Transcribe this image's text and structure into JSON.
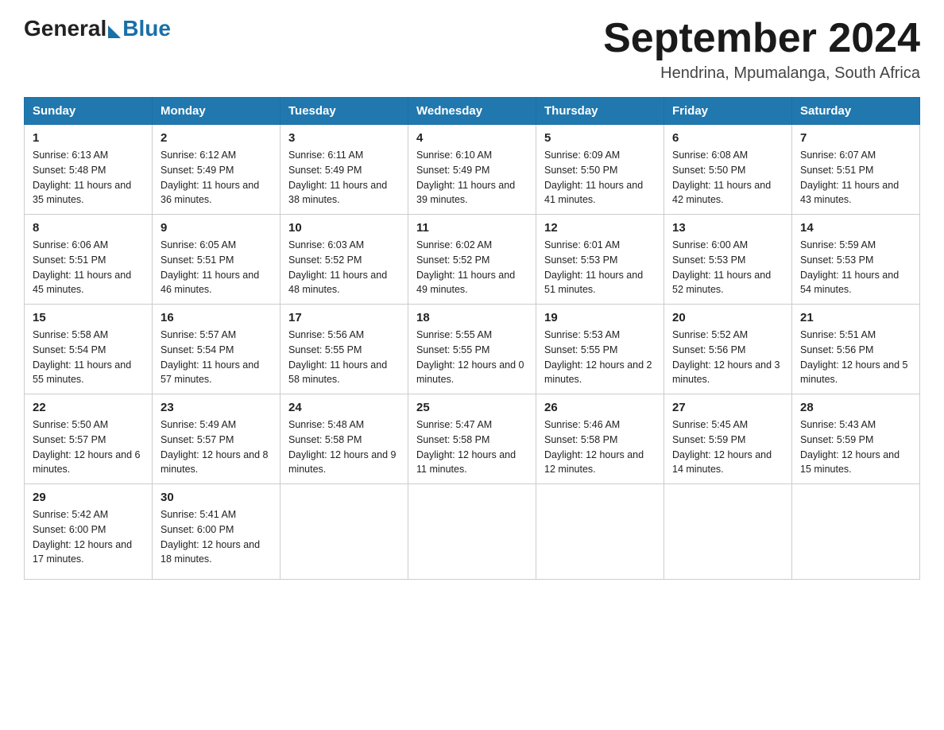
{
  "header": {
    "logo_general": "General",
    "logo_blue": "Blue",
    "month_title": "September 2024",
    "location": "Hendrina, Mpumalanga, South Africa"
  },
  "days_of_week": [
    "Sunday",
    "Monday",
    "Tuesday",
    "Wednesday",
    "Thursday",
    "Friday",
    "Saturday"
  ],
  "weeks": [
    [
      {
        "day": "1",
        "sunrise": "6:13 AM",
        "sunset": "5:48 PM",
        "daylight": "11 hours and 35 minutes."
      },
      {
        "day": "2",
        "sunrise": "6:12 AM",
        "sunset": "5:49 PM",
        "daylight": "11 hours and 36 minutes."
      },
      {
        "day": "3",
        "sunrise": "6:11 AM",
        "sunset": "5:49 PM",
        "daylight": "11 hours and 38 minutes."
      },
      {
        "day": "4",
        "sunrise": "6:10 AM",
        "sunset": "5:49 PM",
        "daylight": "11 hours and 39 minutes."
      },
      {
        "day": "5",
        "sunrise": "6:09 AM",
        "sunset": "5:50 PM",
        "daylight": "11 hours and 41 minutes."
      },
      {
        "day": "6",
        "sunrise": "6:08 AM",
        "sunset": "5:50 PM",
        "daylight": "11 hours and 42 minutes."
      },
      {
        "day": "7",
        "sunrise": "6:07 AM",
        "sunset": "5:51 PM",
        "daylight": "11 hours and 43 minutes."
      }
    ],
    [
      {
        "day": "8",
        "sunrise": "6:06 AM",
        "sunset": "5:51 PM",
        "daylight": "11 hours and 45 minutes."
      },
      {
        "day": "9",
        "sunrise": "6:05 AM",
        "sunset": "5:51 PM",
        "daylight": "11 hours and 46 minutes."
      },
      {
        "day": "10",
        "sunrise": "6:03 AM",
        "sunset": "5:52 PM",
        "daylight": "11 hours and 48 minutes."
      },
      {
        "day": "11",
        "sunrise": "6:02 AM",
        "sunset": "5:52 PM",
        "daylight": "11 hours and 49 minutes."
      },
      {
        "day": "12",
        "sunrise": "6:01 AM",
        "sunset": "5:53 PM",
        "daylight": "11 hours and 51 minutes."
      },
      {
        "day": "13",
        "sunrise": "6:00 AM",
        "sunset": "5:53 PM",
        "daylight": "11 hours and 52 minutes."
      },
      {
        "day": "14",
        "sunrise": "5:59 AM",
        "sunset": "5:53 PM",
        "daylight": "11 hours and 54 minutes."
      }
    ],
    [
      {
        "day": "15",
        "sunrise": "5:58 AM",
        "sunset": "5:54 PM",
        "daylight": "11 hours and 55 minutes."
      },
      {
        "day": "16",
        "sunrise": "5:57 AM",
        "sunset": "5:54 PM",
        "daylight": "11 hours and 57 minutes."
      },
      {
        "day": "17",
        "sunrise": "5:56 AM",
        "sunset": "5:55 PM",
        "daylight": "11 hours and 58 minutes."
      },
      {
        "day": "18",
        "sunrise": "5:55 AM",
        "sunset": "5:55 PM",
        "daylight": "12 hours and 0 minutes."
      },
      {
        "day": "19",
        "sunrise": "5:53 AM",
        "sunset": "5:55 PM",
        "daylight": "12 hours and 2 minutes."
      },
      {
        "day": "20",
        "sunrise": "5:52 AM",
        "sunset": "5:56 PM",
        "daylight": "12 hours and 3 minutes."
      },
      {
        "day": "21",
        "sunrise": "5:51 AM",
        "sunset": "5:56 PM",
        "daylight": "12 hours and 5 minutes."
      }
    ],
    [
      {
        "day": "22",
        "sunrise": "5:50 AM",
        "sunset": "5:57 PM",
        "daylight": "12 hours and 6 minutes."
      },
      {
        "day": "23",
        "sunrise": "5:49 AM",
        "sunset": "5:57 PM",
        "daylight": "12 hours and 8 minutes."
      },
      {
        "day": "24",
        "sunrise": "5:48 AM",
        "sunset": "5:58 PM",
        "daylight": "12 hours and 9 minutes."
      },
      {
        "day": "25",
        "sunrise": "5:47 AM",
        "sunset": "5:58 PM",
        "daylight": "12 hours and 11 minutes."
      },
      {
        "day": "26",
        "sunrise": "5:46 AM",
        "sunset": "5:58 PM",
        "daylight": "12 hours and 12 minutes."
      },
      {
        "day": "27",
        "sunrise": "5:45 AM",
        "sunset": "5:59 PM",
        "daylight": "12 hours and 14 minutes."
      },
      {
        "day": "28",
        "sunrise": "5:43 AM",
        "sunset": "5:59 PM",
        "daylight": "12 hours and 15 minutes."
      }
    ],
    [
      {
        "day": "29",
        "sunrise": "5:42 AM",
        "sunset": "6:00 PM",
        "daylight": "12 hours and 17 minutes."
      },
      {
        "day": "30",
        "sunrise": "5:41 AM",
        "sunset": "6:00 PM",
        "daylight": "12 hours and 18 minutes."
      },
      null,
      null,
      null,
      null,
      null
    ]
  ],
  "labels": {
    "sunrise": "Sunrise:",
    "sunset": "Sunset:",
    "daylight": "Daylight:"
  }
}
